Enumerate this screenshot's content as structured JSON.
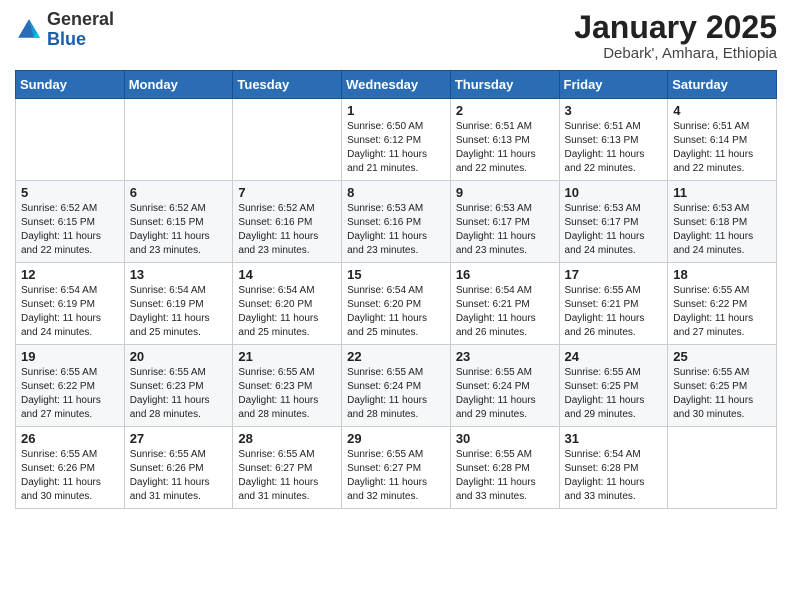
{
  "logo": {
    "general": "General",
    "blue": "Blue"
  },
  "title": "January 2025",
  "subtitle": "Debark', Amhara, Ethiopia",
  "days_header": [
    "Sunday",
    "Monday",
    "Tuesday",
    "Wednesday",
    "Thursday",
    "Friday",
    "Saturday"
  ],
  "weeks": [
    [
      {
        "day": "",
        "sunrise": "",
        "sunset": "",
        "daylight": ""
      },
      {
        "day": "",
        "sunrise": "",
        "sunset": "",
        "daylight": ""
      },
      {
        "day": "",
        "sunrise": "",
        "sunset": "",
        "daylight": ""
      },
      {
        "day": "1",
        "sunrise": "Sunrise: 6:50 AM",
        "sunset": "Sunset: 6:12 PM",
        "daylight": "Daylight: 11 hours and 21 minutes."
      },
      {
        "day": "2",
        "sunrise": "Sunrise: 6:51 AM",
        "sunset": "Sunset: 6:13 PM",
        "daylight": "Daylight: 11 hours and 22 minutes."
      },
      {
        "day": "3",
        "sunrise": "Sunrise: 6:51 AM",
        "sunset": "Sunset: 6:13 PM",
        "daylight": "Daylight: 11 hours and 22 minutes."
      },
      {
        "day": "4",
        "sunrise": "Sunrise: 6:51 AM",
        "sunset": "Sunset: 6:14 PM",
        "daylight": "Daylight: 11 hours and 22 minutes."
      }
    ],
    [
      {
        "day": "5",
        "sunrise": "Sunrise: 6:52 AM",
        "sunset": "Sunset: 6:15 PM",
        "daylight": "Daylight: 11 hours and 22 minutes."
      },
      {
        "day": "6",
        "sunrise": "Sunrise: 6:52 AM",
        "sunset": "Sunset: 6:15 PM",
        "daylight": "Daylight: 11 hours and 23 minutes."
      },
      {
        "day": "7",
        "sunrise": "Sunrise: 6:52 AM",
        "sunset": "Sunset: 6:16 PM",
        "daylight": "Daylight: 11 hours and 23 minutes."
      },
      {
        "day": "8",
        "sunrise": "Sunrise: 6:53 AM",
        "sunset": "Sunset: 6:16 PM",
        "daylight": "Daylight: 11 hours and 23 minutes."
      },
      {
        "day": "9",
        "sunrise": "Sunrise: 6:53 AM",
        "sunset": "Sunset: 6:17 PM",
        "daylight": "Daylight: 11 hours and 23 minutes."
      },
      {
        "day": "10",
        "sunrise": "Sunrise: 6:53 AM",
        "sunset": "Sunset: 6:17 PM",
        "daylight": "Daylight: 11 hours and 24 minutes."
      },
      {
        "day": "11",
        "sunrise": "Sunrise: 6:53 AM",
        "sunset": "Sunset: 6:18 PM",
        "daylight": "Daylight: 11 hours and 24 minutes."
      }
    ],
    [
      {
        "day": "12",
        "sunrise": "Sunrise: 6:54 AM",
        "sunset": "Sunset: 6:19 PM",
        "daylight": "Daylight: 11 hours and 24 minutes."
      },
      {
        "day": "13",
        "sunrise": "Sunrise: 6:54 AM",
        "sunset": "Sunset: 6:19 PM",
        "daylight": "Daylight: 11 hours and 25 minutes."
      },
      {
        "day": "14",
        "sunrise": "Sunrise: 6:54 AM",
        "sunset": "Sunset: 6:20 PM",
        "daylight": "Daylight: 11 hours and 25 minutes."
      },
      {
        "day": "15",
        "sunrise": "Sunrise: 6:54 AM",
        "sunset": "Sunset: 6:20 PM",
        "daylight": "Daylight: 11 hours and 25 minutes."
      },
      {
        "day": "16",
        "sunrise": "Sunrise: 6:54 AM",
        "sunset": "Sunset: 6:21 PM",
        "daylight": "Daylight: 11 hours and 26 minutes."
      },
      {
        "day": "17",
        "sunrise": "Sunrise: 6:55 AM",
        "sunset": "Sunset: 6:21 PM",
        "daylight": "Daylight: 11 hours and 26 minutes."
      },
      {
        "day": "18",
        "sunrise": "Sunrise: 6:55 AM",
        "sunset": "Sunset: 6:22 PM",
        "daylight": "Daylight: 11 hours and 27 minutes."
      }
    ],
    [
      {
        "day": "19",
        "sunrise": "Sunrise: 6:55 AM",
        "sunset": "Sunset: 6:22 PM",
        "daylight": "Daylight: 11 hours and 27 minutes."
      },
      {
        "day": "20",
        "sunrise": "Sunrise: 6:55 AM",
        "sunset": "Sunset: 6:23 PM",
        "daylight": "Daylight: 11 hours and 28 minutes."
      },
      {
        "day": "21",
        "sunrise": "Sunrise: 6:55 AM",
        "sunset": "Sunset: 6:23 PM",
        "daylight": "Daylight: 11 hours and 28 minutes."
      },
      {
        "day": "22",
        "sunrise": "Sunrise: 6:55 AM",
        "sunset": "Sunset: 6:24 PM",
        "daylight": "Daylight: 11 hours and 28 minutes."
      },
      {
        "day": "23",
        "sunrise": "Sunrise: 6:55 AM",
        "sunset": "Sunset: 6:24 PM",
        "daylight": "Daylight: 11 hours and 29 minutes."
      },
      {
        "day": "24",
        "sunrise": "Sunrise: 6:55 AM",
        "sunset": "Sunset: 6:25 PM",
        "daylight": "Daylight: 11 hours and 29 minutes."
      },
      {
        "day": "25",
        "sunrise": "Sunrise: 6:55 AM",
        "sunset": "Sunset: 6:25 PM",
        "daylight": "Daylight: 11 hours and 30 minutes."
      }
    ],
    [
      {
        "day": "26",
        "sunrise": "Sunrise: 6:55 AM",
        "sunset": "Sunset: 6:26 PM",
        "daylight": "Daylight: 11 hours and 30 minutes."
      },
      {
        "day": "27",
        "sunrise": "Sunrise: 6:55 AM",
        "sunset": "Sunset: 6:26 PM",
        "daylight": "Daylight: 11 hours and 31 minutes."
      },
      {
        "day": "28",
        "sunrise": "Sunrise: 6:55 AM",
        "sunset": "Sunset: 6:27 PM",
        "daylight": "Daylight: 11 hours and 31 minutes."
      },
      {
        "day": "29",
        "sunrise": "Sunrise: 6:55 AM",
        "sunset": "Sunset: 6:27 PM",
        "daylight": "Daylight: 11 hours and 32 minutes."
      },
      {
        "day": "30",
        "sunrise": "Sunrise: 6:55 AM",
        "sunset": "Sunset: 6:28 PM",
        "daylight": "Daylight: 11 hours and 33 minutes."
      },
      {
        "day": "31",
        "sunrise": "Sunrise: 6:54 AM",
        "sunset": "Sunset: 6:28 PM",
        "daylight": "Daylight: 11 hours and 33 minutes."
      },
      {
        "day": "",
        "sunrise": "",
        "sunset": "",
        "daylight": ""
      }
    ]
  ]
}
